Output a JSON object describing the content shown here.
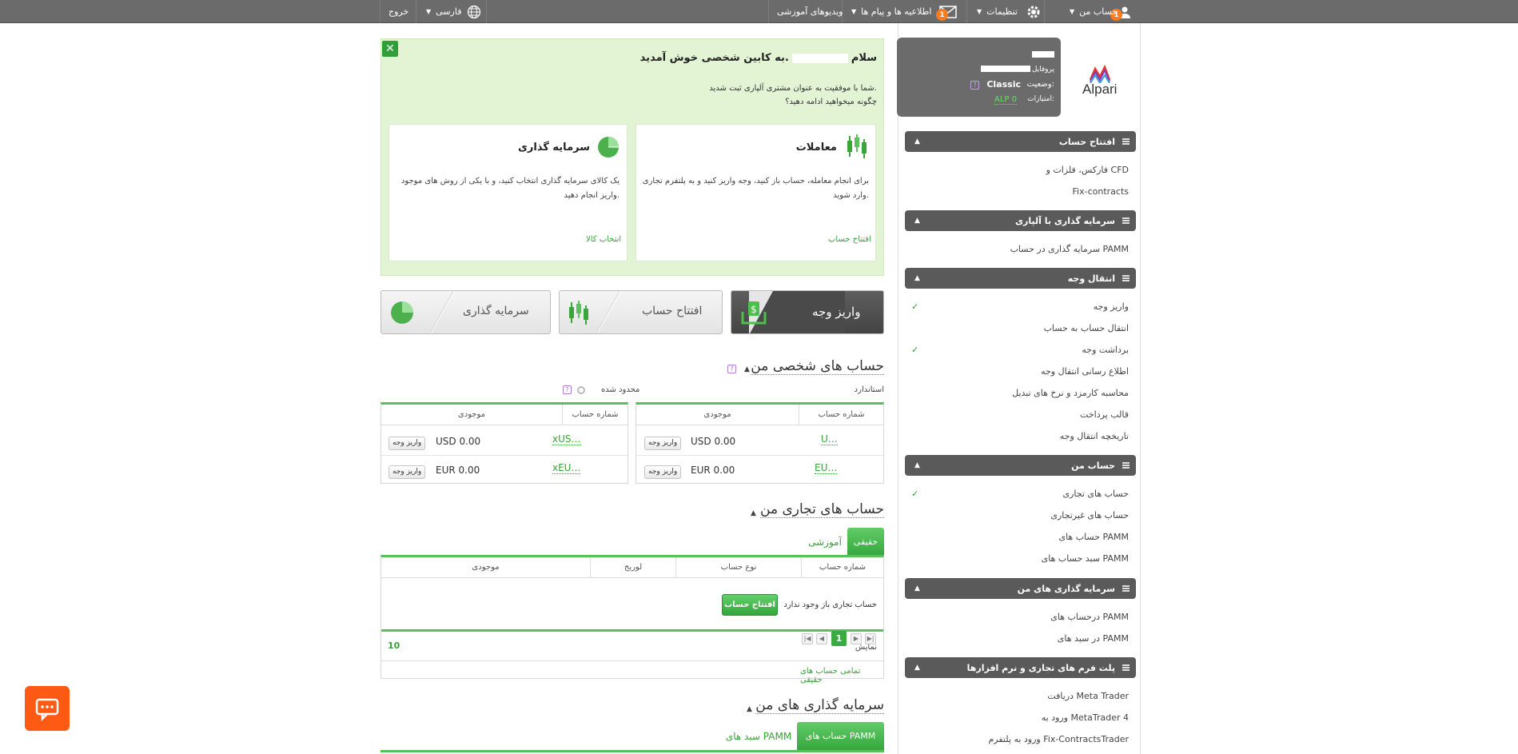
{
  "topbar": {
    "account_label": "حساب من",
    "account_badge": "1",
    "settings_label": "تنظیمات",
    "messages_label": "اطلاعیه ها و پیام ها",
    "messages_badge": "1",
    "videos_label": "ویدیوهای آموزشی",
    "language_label": "فارسی",
    "logout_label": "خروج"
  },
  "profile": {
    "profile_label": "پروفایل",
    "status_label": "وضعیت:",
    "status_value": "Classic",
    "points_label": "امتیازات:",
    "points_value": "ALP 0",
    "logo_text": "Alpari"
  },
  "sidebar": [
    {
      "title": "افتتاح حساب",
      "items": [
        {
          "label": "فارکس، فلزات و CFD"
        },
        {
          "label": "Fix-contracts"
        }
      ]
    },
    {
      "title": "سرمایه گذاری با آلپاری",
      "items": [
        {
          "label": "سرمایه گذاری در حساب PAMM"
        }
      ]
    },
    {
      "title": "انتقال وجه",
      "items": [
        {
          "label": "واریز وجه",
          "check": "✓"
        },
        {
          "label": "انتقال حساب به حساب"
        },
        {
          "label": "برداشت وجه",
          "check": "✓"
        },
        {
          "label": "اطلاع رسانی انتقال وجه"
        },
        {
          "label": "محاسبه کارمزد و نرخ های تبدیل"
        },
        {
          "label": "قالب پرداخت"
        },
        {
          "label": "تاریخچه انتقال وجه"
        }
      ]
    },
    {
      "title": "حساب من",
      "items": [
        {
          "label": "حساب های تجاری",
          "check": "✓"
        },
        {
          "label": "حساب های غیرتجاری"
        },
        {
          "label": "حساب های PAMM"
        },
        {
          "label": "سبد حساب های PAMM"
        }
      ]
    },
    {
      "title": "سرمایه گذاری های من",
      "items": [
        {
          "label": "درحساب های PAMM"
        },
        {
          "label": "در سبد های PAMM"
        }
      ]
    },
    {
      "title": "پلت فرم های تجاری و نرم افزارها",
      "items": [
        {
          "label": "دریافت Meta Trader"
        },
        {
          "label": "ورود به MetaTrader 4"
        },
        {
          "label": "ورود به پلتفرم Fix-ContractsTrader"
        }
      ]
    }
  ],
  "welcome": {
    "greeting_start": "سلام",
    "greeting_end": "به کابین شخصی خوش آمدید.",
    "line1": "شما با موفقیت به عنوان مشتری آلپاری ثبت شدید.",
    "line2": "چگونه میخواهید ادامه دهید؟",
    "trade_title": "معاملات",
    "trade_desc": "برای انجام معامله، حساب باز کنید، وجه واریز کنید و به پلتفرم تجاری وارد شوید.",
    "trade_link": "افتتاح حساب",
    "invest_title": "سرمایه گذاری",
    "invest_desc": "یک کالای سرمایه گذاری انتخاب کنید، و با یکی از روش های موجود واریز انجام دهید.",
    "invest_link": "انتخاب کالا"
  },
  "bigtabs": {
    "deposit": "واریز وجه",
    "open_account": "افتتاح حساب",
    "invest": "سرمایه گذاری"
  },
  "personal": {
    "title": "حساب های شخصی من",
    "standard_label": "استاندارد",
    "limited_label": "محدود شده",
    "col_account": "شماره حساب",
    "col_balance": "موجودی",
    "deposit_btn": "واریز وجه",
    "standard_rows": [
      {
        "account": "U…",
        "balance": "USD 0.00"
      },
      {
        "account": "EU…",
        "balance": "EUR 0.00"
      }
    ],
    "limited_rows": [
      {
        "account": "xUS…",
        "balance": "USD 0.00"
      },
      {
        "account": "xEU…",
        "balance": "EUR 0.00"
      }
    ]
  },
  "trading": {
    "title": "حساب های تجاری من",
    "tab_real": "حقیقی",
    "tab_demo": "آموزشی",
    "col_account": "شماره حساب",
    "col_type": "نوع حساب",
    "col_leverage": "لوریج",
    "col_balance": "موجودی",
    "empty_text": "حساب تجاری باز وجود ندارد",
    "open_btn": "افتتاح حساب",
    "page": "1",
    "show_label": "نمایش",
    "show_value": "10",
    "all_link": "تمامی حساب های حقیقی"
  },
  "investments": {
    "title": "سرمایه گذاری های من",
    "tab_pamm": "حساب های PAMM",
    "tab_portfolio": "سبد های PAMM"
  },
  "colors": {
    "accent": "#3a9f3a",
    "topbar": "#6b6b6b",
    "badge": "#ff7a1a",
    "chat": "#ff5a14"
  }
}
